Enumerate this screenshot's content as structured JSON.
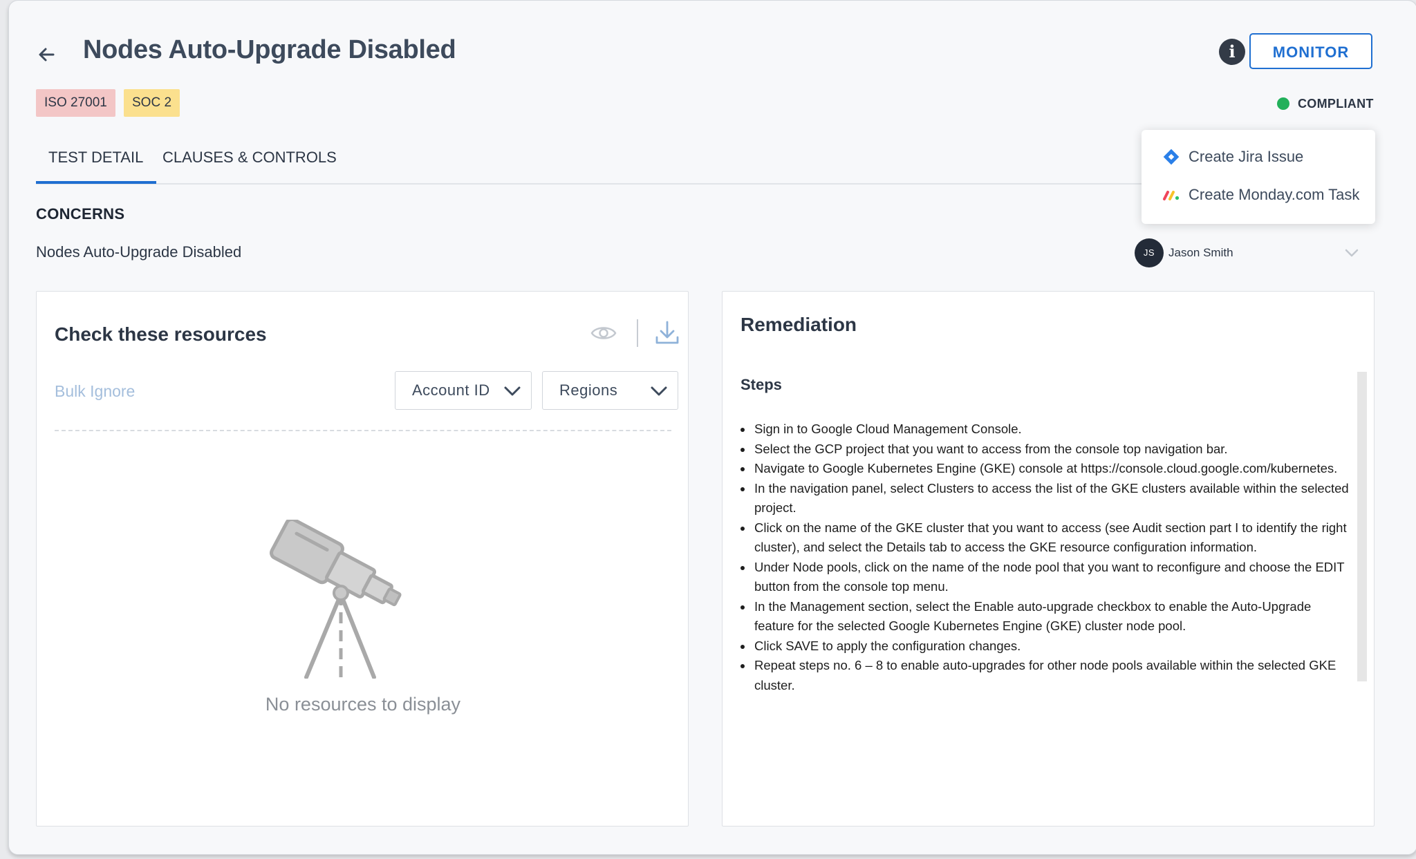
{
  "header": {
    "title": "Nodes Auto-Upgrade Disabled",
    "monitor_label": "MONITOR",
    "info_label": "i",
    "status_label": "COMPLIANT",
    "status_color": "#22b05a",
    "badges": [
      {
        "label": "ISO 27001",
        "color": "#f3c6c6"
      },
      {
        "label": "SOC 2",
        "color": "#fbe08e"
      }
    ]
  },
  "tabs": [
    {
      "label": "TEST DETAIL",
      "active": true
    },
    {
      "label": "CLAUSES & CONTROLS",
      "active": false
    }
  ],
  "concerns": {
    "heading": "CONCERNS",
    "text": "Nodes Auto-Upgrade Disabled"
  },
  "assignee": {
    "initials": "JS",
    "name": "Jason Smith"
  },
  "menu": {
    "items": [
      {
        "label": "Create Jira Issue",
        "icon": "jira-icon"
      },
      {
        "label": "Create Monday.com Task",
        "icon": "monday-icon"
      }
    ]
  },
  "resources": {
    "title": "Check these resources",
    "bulk_ignore": "Bulk Ignore",
    "account_select": "Account ID",
    "regions_select": "Regions",
    "empty_text": "No resources to display"
  },
  "remediation": {
    "title": "Remediation",
    "steps_heading": "Steps",
    "steps": [
      "Sign in to Google Cloud Management Console.",
      "Select the GCP project that you want to access from the console top navigation bar.",
      "Navigate to Google Kubernetes Engine (GKE) console at https://console.cloud.google.com/kubernetes.",
      "In the navigation panel, select Clusters to access the list of the GKE clusters available within the selected project.",
      "Click on the name of the GKE cluster that you want to access (see Audit section part I to identify the right cluster), and select the Details tab to access the GKE resource configuration information.",
      "Under Node pools, click on the name of the node pool that you want to reconfigure and choose the EDIT button from the console top menu.",
      "In the Management section, select the Enable auto-upgrade checkbox to enable the Auto-Upgrade feature for the selected Google Kubernetes Engine (GKE) cluster node pool.",
      "Click SAVE to apply the configuration changes.",
      "Repeat steps no. 6 – 8 to enable auto-upgrades for other node pools available within the selected GKE cluster."
    ]
  },
  "colors": {
    "accent": "#1f6fd1",
    "title": "#3d4a5c"
  }
}
